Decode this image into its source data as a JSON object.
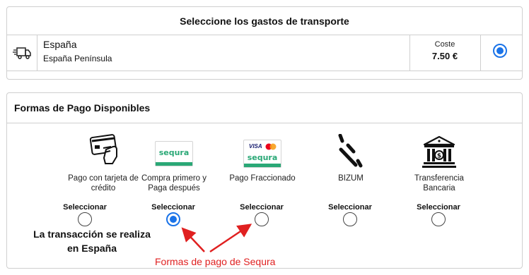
{
  "shipping": {
    "title": "Seleccione los gastos de transporte",
    "option": {
      "icon": "delivery-truck-icon",
      "country": "España",
      "region": "España Península",
      "cost_label": "Coste",
      "cost_value": "7.50 €",
      "selected": true
    }
  },
  "payment": {
    "title": "Formas de Pago Disponibles",
    "select_label": "Seleccionar",
    "methods": [
      {
        "icon": "card-payment-icon",
        "label": "Pago con tarjeta de crédito",
        "selected": false
      },
      {
        "icon": "sequra-logo",
        "logo_text": "sequra",
        "label": "Compra primero y Paga después",
        "selected": true
      },
      {
        "icon": "sequra-visa-mastercard-logo",
        "logo_text": "sequra",
        "card_text": "VISA",
        "label": "Pago Fraccionado",
        "selected": false
      },
      {
        "icon": "bizum-icon",
        "label": "BIZUM",
        "selected": false
      },
      {
        "icon": "bank-building-icon",
        "label": "Transferencia Bancaria",
        "selected": false
      }
    ],
    "note": "La transacción se realiza en España"
  },
  "annotation": {
    "text": "Formas de pago de Sequra",
    "color": "#e02020"
  },
  "colors": {
    "accent": "#1a73e8",
    "sequra_green": "#2aa876"
  }
}
